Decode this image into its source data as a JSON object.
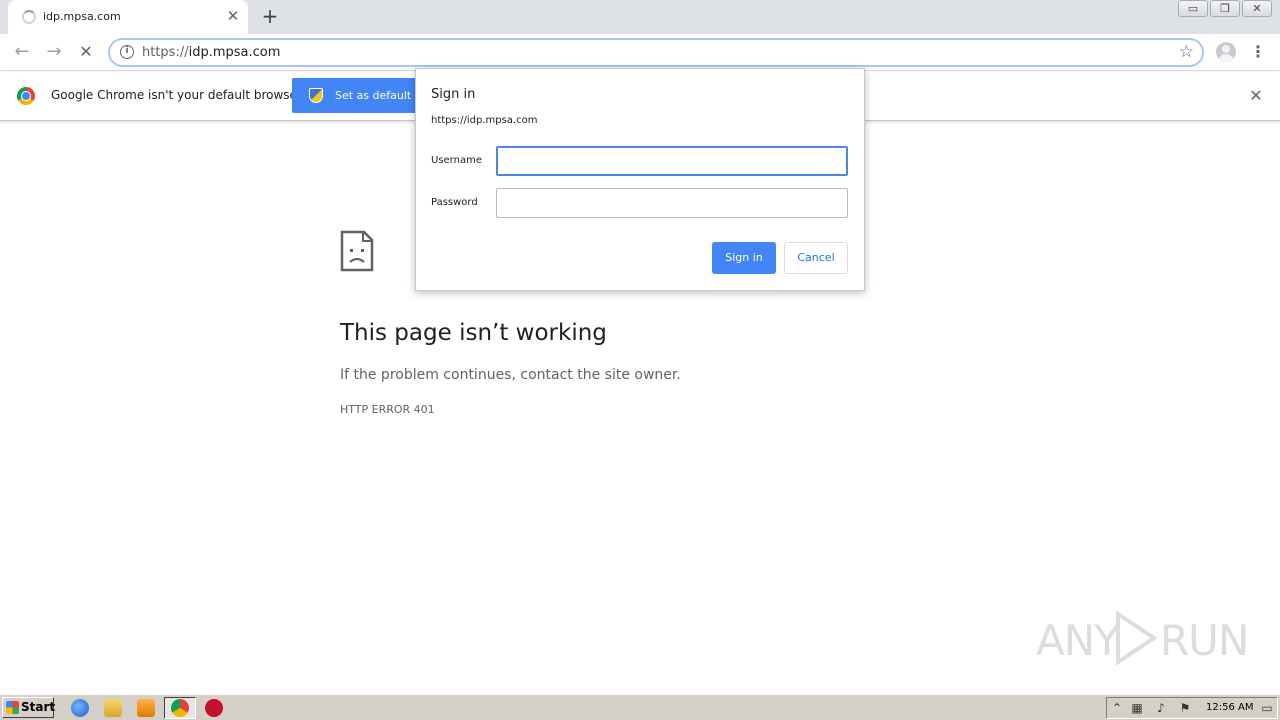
{
  "browser": {
    "tab": {
      "title": "idp.mpsa.com",
      "close_glyph": "✕"
    },
    "new_tab_glyph": "+",
    "window_controls": {
      "minimize": "▭",
      "restore": "❐",
      "close": "✕"
    },
    "nav": {
      "back": "←",
      "forward": "→",
      "stop": "✕"
    },
    "omnibox": {
      "scheme": "https://",
      "host": "idp.mpsa.com",
      "info_glyph": "i",
      "star_glyph": "☆"
    },
    "menu_glyph": "⋮"
  },
  "infobar": {
    "message": "Google Chrome isn't your default browser",
    "button_label": "Set as default",
    "close_glyph": "✕"
  },
  "error_page": {
    "title": "This page isn’t working",
    "description": "If the problem continues, contact the site owner.",
    "code": "HTTP ERROR 401"
  },
  "dialog": {
    "title": "Sign in",
    "origin": "https://idp.mpsa.com",
    "username_label": "Username",
    "username_value": "",
    "password_label": "Password",
    "password_value": "",
    "signin_label": "Sign in",
    "cancel_label": "Cancel",
    "colors": {
      "primary": "#4285f4",
      "focus": "#4a86e8"
    }
  },
  "watermark": {
    "left": "ANY",
    "right": "RUN"
  },
  "taskbar": {
    "start_label": "Start",
    "clock": "12:56 AM",
    "tray_icons": [
      "chevron-up-icon",
      "network-icon",
      "speaker-icon",
      "flag-icon",
      "desktop-icon"
    ]
  }
}
